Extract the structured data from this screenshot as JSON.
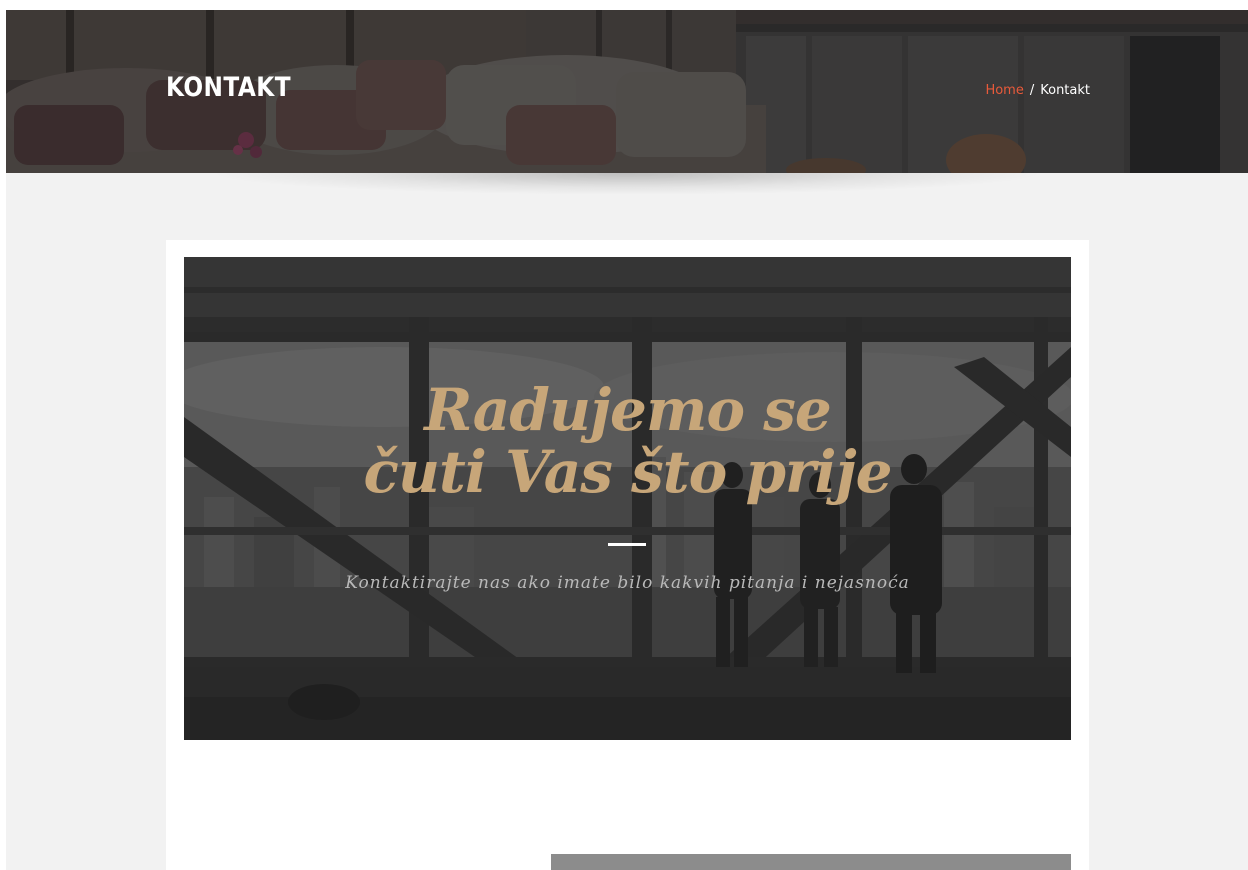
{
  "header": {
    "title": "KONTAKT",
    "breadcrumb": {
      "home_label": "Home",
      "separator": "/",
      "current_label": "Kontakt"
    }
  },
  "hero": {
    "heading_line1": "Radujemo se",
    "heading_line2": "čuti Vas što prije",
    "subtitle": "Kontaktirajte nas ako imate bilo kakvih pitanja i nejasnoća"
  },
  "colors": {
    "background": "#f2f2f2",
    "card": "#ffffff",
    "heading_gold": "#c7a679",
    "breadcrumb_link": "#e85a3a",
    "subtitle_gray": "#b9b9b9"
  }
}
